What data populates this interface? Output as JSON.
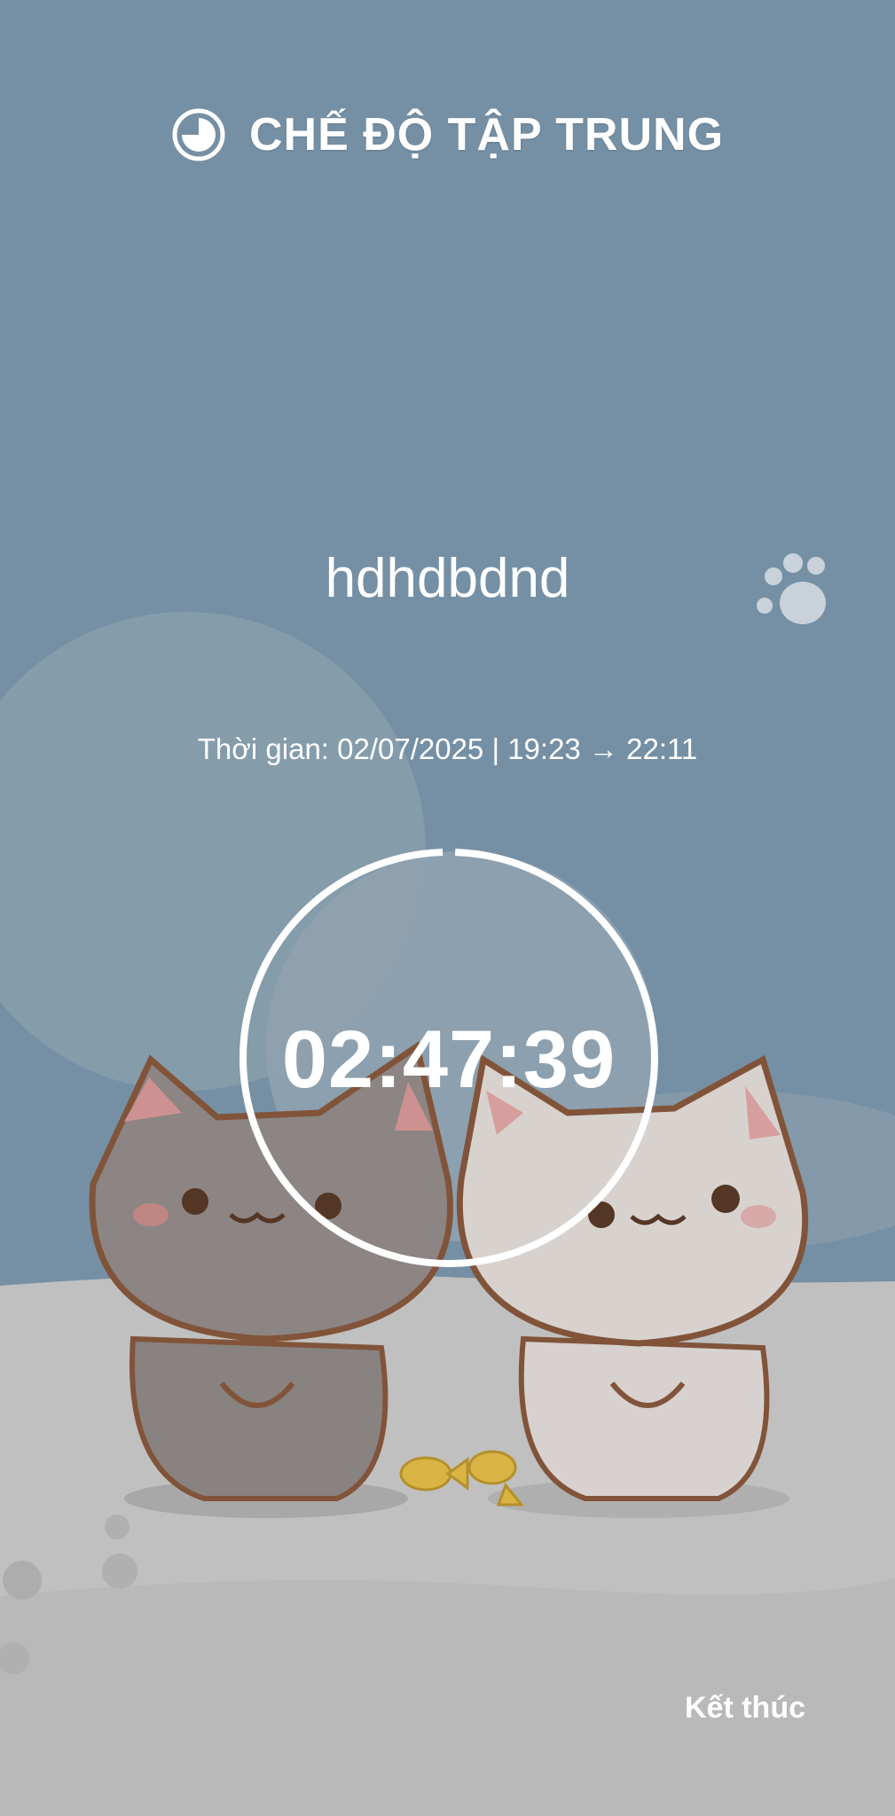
{
  "header": {
    "title": "CHẾ ĐỘ TẬP TRUNG",
    "icon": "focus-timer-icon"
  },
  "task": {
    "name": "hdhdbdnd"
  },
  "schedule": {
    "time_range": "Thời gian: 02/07/2025 | 19:23 → 22:11"
  },
  "timer": {
    "remaining": "02:47:39",
    "progress": 0.99
  },
  "actions": {
    "end_label": "Kết thúc"
  },
  "colors": {
    "sky": "#6d8aa0",
    "ground": "#bdbdbd",
    "accent": "#ffffff"
  }
}
